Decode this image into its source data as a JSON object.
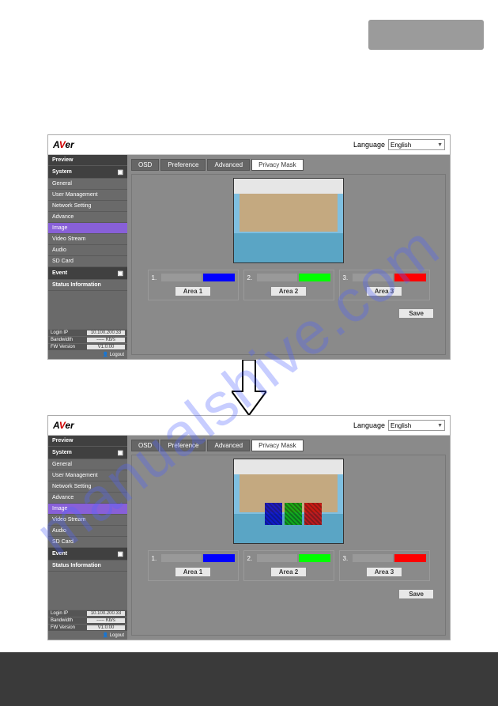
{
  "topButton": "",
  "watermark": "manualshive.com",
  "ui": {
    "logo_a": "A",
    "logo_v": "V",
    "logo_er": "er",
    "language_label": "Language",
    "language_value": "English",
    "sidebar": {
      "preview": "Preview",
      "system": "System",
      "general": "General",
      "user_management": "User Management",
      "network_setting": "Network Setting",
      "advance": "Advance",
      "image": "Image",
      "video_stream": "Video Stream",
      "audio": "Audio",
      "sd_card": "SD Card",
      "event": "Event",
      "status_info": "Status Information",
      "info": {
        "login_ip_label": "Login IP",
        "login_ip_value": "10.100.200.33",
        "bandwidth_label": "Bandwidth",
        "bandwidth_value": "----- Kb/s",
        "fw_label": "FW Version",
        "fw_value": "V1.0.00"
      },
      "logout": "Logout"
    },
    "tabs": {
      "osd": "OSD",
      "preference": "Preference",
      "advanced": "Advanced",
      "privacy_mask": "Privacy Mask"
    },
    "areas": {
      "n1": "1.",
      "n2": "2.",
      "n3": "3.",
      "a1": "Area 1",
      "a2": "Area 2",
      "a3": "Area 3"
    },
    "save": "Save"
  }
}
